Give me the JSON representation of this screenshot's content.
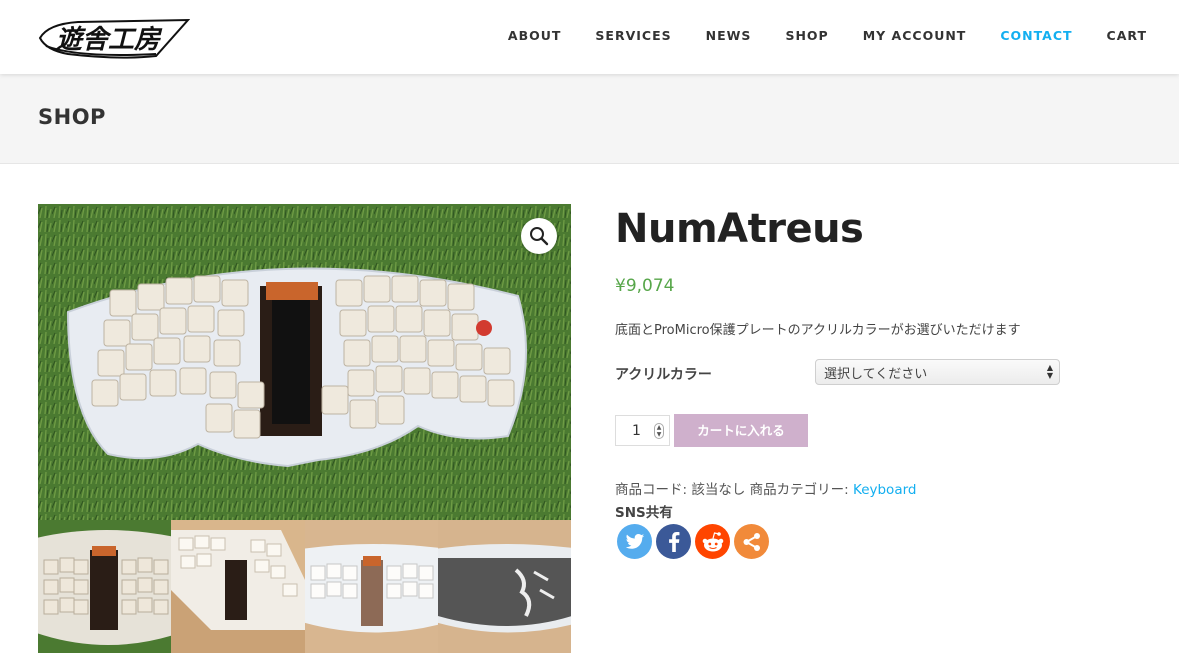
{
  "header": {
    "logo_text": "遊舎工房",
    "nav": [
      {
        "label": "ABOUT",
        "active": false
      },
      {
        "label": "SERVICES",
        "active": false
      },
      {
        "label": "NEWS",
        "active": false
      },
      {
        "label": "SHOP",
        "active": false
      },
      {
        "label": "MY ACCOUNT",
        "active": false
      },
      {
        "label": "CONTACT",
        "active": true
      },
      {
        "label": "CART",
        "active": false
      }
    ],
    "accent_color": "#13aff0"
  },
  "page_title": "SHOP",
  "gallery": {
    "zoom_icon": "magnifier-icon",
    "thumbnail_count": 4
  },
  "product": {
    "title": "NumAtreus",
    "price": "¥9,074",
    "price_color": "#57a64a",
    "description": "底面とProMicro保護プレートのアクリルカラーがお選びいただけます",
    "variation_label": "アクリルカラー",
    "variation_selected": "選択してください",
    "quantity": "1",
    "add_to_cart_label": "カートに入れる",
    "add_to_cart_color": "#cfb0cc",
    "sku_label": "商品コード:",
    "sku_value": "該当なし",
    "category_label": "商品カテゴリー:",
    "category_value": "Keyboard"
  },
  "sns": {
    "label": "SNS共有",
    "buttons": [
      {
        "name": "twitter",
        "icon": "twitter-icon",
        "color": "#55acee"
      },
      {
        "name": "facebook",
        "icon": "facebook-icon",
        "color": "#3b5998"
      },
      {
        "name": "reddit",
        "icon": "reddit-icon",
        "color": "#ff4500"
      },
      {
        "name": "more",
        "icon": "share-icon",
        "color": "#f18a3a"
      }
    ]
  }
}
